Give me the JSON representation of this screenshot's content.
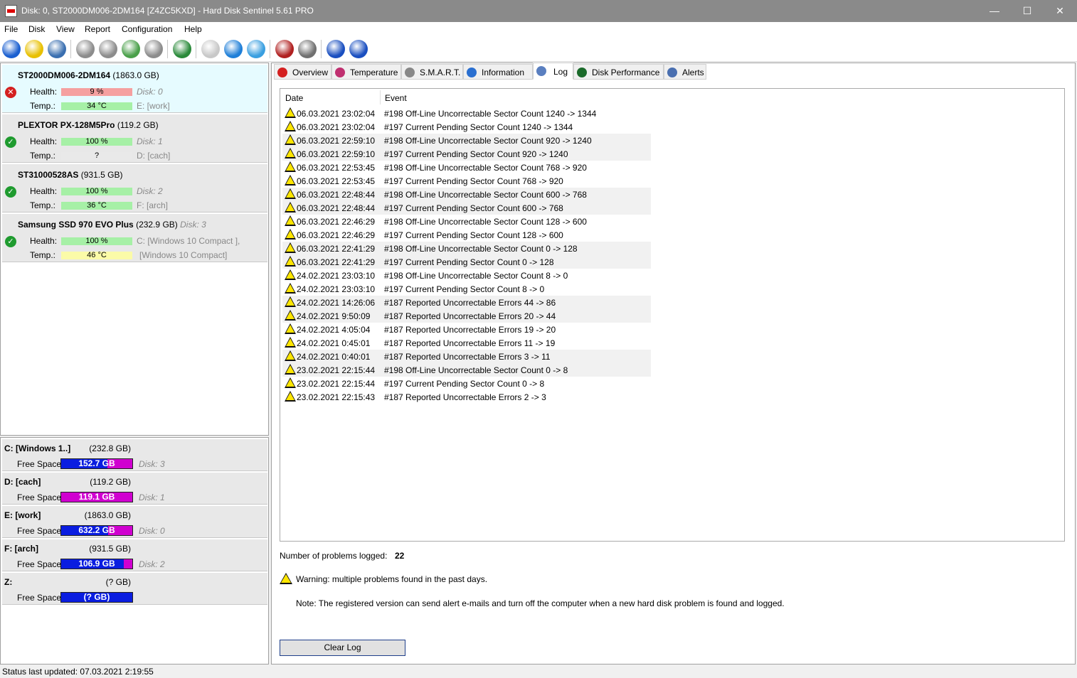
{
  "window": {
    "title": "Disk: 0, ST2000DM006-2DM164 [Z4ZC5KXD]  -  Hard Disk Sentinel 5.61 PRO",
    "minimize": "—",
    "maximize": "☐",
    "close": "✕"
  },
  "menu": [
    "File",
    "Disk",
    "View",
    "Report",
    "Configuration",
    "Help"
  ],
  "toolbar": {
    "icons": [
      "refresh-icon",
      "alert-icon",
      "disk-icon",
      "hdd-icon-1",
      "hdd-icon-2",
      "hdd-icon-3",
      "hdd-icon-4",
      "globe-icon",
      "report-icon",
      "sync-icon",
      "network-icon",
      "chart-icon",
      "sound-icon",
      "help-icon",
      "info-icon"
    ],
    "colors": [
      "#1a5fd0",
      "#e8c000",
      "#3a6fb0",
      "#8c8c8c",
      "#8c8c8c",
      "#4aa04a",
      "#8c8c8c",
      "#2a8a3a",
      "#c8c8c8",
      "#1f7fd8",
      "#3a9fe0",
      "#b02020",
      "#707070",
      "#1a4fc0",
      "#1a4fc0"
    ]
  },
  "disks": [
    {
      "name": "ST2000DM006-2DM164",
      "size": "(1863.0 GB)",
      "disk_no": "",
      "status": "bad",
      "health_label": "Health:",
      "health": "9 %",
      "health_fraction": 0.09,
      "health_color": "red",
      "temp_label": "Temp.:",
      "temp": "34 °C",
      "temp_color": "green",
      "info1": "Disk: 0",
      "info2": "E: [work]"
    },
    {
      "name": "PLEXTOR PX-128M5Pro",
      "size": "(119.2 GB)",
      "disk_no": "",
      "status": "ok",
      "health_label": "Health:",
      "health": "100 %",
      "health_fraction": 1.0,
      "health_color": "green",
      "temp_label": "Temp.:",
      "temp": "?",
      "temp_color": "gray",
      "info1": "Disk: 1",
      "info2": "D: [cach]"
    },
    {
      "name": "ST31000528AS",
      "size": "(931.5 GB)",
      "disk_no": "",
      "status": "ok",
      "health_label": "Health:",
      "health": "100 %",
      "health_fraction": 1.0,
      "health_color": "green",
      "temp_label": "Temp.:",
      "temp": "36 °C",
      "temp_color": "green",
      "info1": "Disk: 2",
      "info2": "F: [arch]"
    },
    {
      "name": "Samsung SSD 970 EVO Plus",
      "size": "(232.9 GB)",
      "disk_no": "Disk: 3",
      "status": "ok",
      "health_label": "Health:",
      "health": "100 %",
      "health_fraction": 1.0,
      "health_color": "green",
      "temp_label": "Temp.:",
      "temp": "46 °C",
      "temp_color": "yellow",
      "info1": "C: [Windows 10 Compact ],",
      "info2": "[Windows 10 Compact]"
    }
  ],
  "volumes": [
    {
      "name": "C: [Windows 1..]",
      "size": "(232.8 GB)",
      "free_label": "Free Space",
      "free": "152.7 GB",
      "free_fraction": 0.65,
      "disk": "Disk: 3"
    },
    {
      "name": "D: [cach]",
      "size": "(119.2 GB)",
      "free_label": "Free Space",
      "free": "119.1 GB",
      "free_fraction": 0.0,
      "disk": "Disk: 1"
    },
    {
      "name": "E: [work]",
      "size": "(1863.0 GB)",
      "free_label": "Free Space",
      "free": "632.2 GB",
      "free_fraction": 0.66,
      "disk": "Disk: 0"
    },
    {
      "name": "F: [arch]",
      "size": "(931.5 GB)",
      "free_label": "Free Space",
      "free": "106.9 GB",
      "free_fraction": 0.88,
      "disk": "Disk: 2"
    },
    {
      "name": "Z:",
      "size": "(? GB)",
      "free_label": "Free Space",
      "free": "(? GB)",
      "free_fraction": 1.0,
      "disk": ""
    }
  ],
  "tabs": [
    {
      "label": "Overview",
      "icon": "error-icon",
      "color": "#d42020"
    },
    {
      "label": "Temperature",
      "icon": "thermometer-icon",
      "color": "#c03070"
    },
    {
      "label": "S.M.A.R.T.",
      "icon": "smart-icon",
      "color": "#888888"
    },
    {
      "label": "Information",
      "icon": "info-icon",
      "color": "#2a6fd0"
    },
    {
      "label": "Log",
      "icon": "log-icon",
      "color": "#5a7fc0"
    },
    {
      "label": "Disk Performance",
      "icon": "performance-icon",
      "color": "#1a6a2a"
    },
    {
      "label": "Alerts",
      "icon": "alerts-icon",
      "color": "#4a6fb0"
    }
  ],
  "active_tab": "Log",
  "log": {
    "header_date": "Date",
    "header_event": "Event",
    "rows": [
      {
        "date": "06.03.2021 23:02:04",
        "event": "#198  Off-Line Uncorrectable Sector Count  1240 -> 1344"
      },
      {
        "date": "06.03.2021 23:02:04",
        "event": "#197  Current Pending Sector Count  1240 -> 1344"
      },
      {
        "date": "06.03.2021 22:59:10",
        "event": "#198  Off-Line Uncorrectable Sector Count  920 -> 1240"
      },
      {
        "date": "06.03.2021 22:59:10",
        "event": "#197  Current Pending Sector Count  920 -> 1240"
      },
      {
        "date": "06.03.2021 22:53:45",
        "event": "#198  Off-Line Uncorrectable Sector Count  768 -> 920"
      },
      {
        "date": "06.03.2021 22:53:45",
        "event": "#197  Current Pending Sector Count  768 -> 920"
      },
      {
        "date": "06.03.2021 22:48:44",
        "event": "#198  Off-Line Uncorrectable Sector Count  600 -> 768"
      },
      {
        "date": "06.03.2021 22:48:44",
        "event": "#197  Current Pending Sector Count  600 -> 768"
      },
      {
        "date": "06.03.2021 22:46:29",
        "event": "#198  Off-Line Uncorrectable Sector Count  128 -> 600"
      },
      {
        "date": "06.03.2021 22:46:29",
        "event": "#197  Current Pending Sector Count  128 -> 600"
      },
      {
        "date": "06.03.2021 22:41:29",
        "event": "#198  Off-Line Uncorrectable Sector Count  0 -> 128"
      },
      {
        "date": "06.03.2021 22:41:29",
        "event": "#197  Current Pending Sector Count  0 -> 128"
      },
      {
        "date": "24.02.2021 23:03:10",
        "event": "#198  Off-Line Uncorrectable Sector Count  8 -> 0"
      },
      {
        "date": "24.02.2021 23:03:10",
        "event": "#197  Current Pending Sector Count  8 -> 0"
      },
      {
        "date": "24.02.2021 14:26:06",
        "event": "#187  Reported Uncorrectable Errors  44 -> 86"
      },
      {
        "date": "24.02.2021 9:50:09",
        "event": "#187  Reported Uncorrectable Errors  20 -> 44"
      },
      {
        "date": "24.02.2021 4:05:04",
        "event": "#187  Reported Uncorrectable Errors  19 -> 20"
      },
      {
        "date": "24.02.2021 0:45:01",
        "event": "#187  Reported Uncorrectable Errors  11 -> 19"
      },
      {
        "date": "24.02.2021 0:40:01",
        "event": "#187  Reported Uncorrectable Errors  3 -> 11"
      },
      {
        "date": "23.02.2021 22:15:44",
        "event": "#198  Off-Line Uncorrectable Sector Count  0 -> 8"
      },
      {
        "date": "23.02.2021 22:15:44",
        "event": "#197  Current Pending Sector Count  0 -> 8"
      },
      {
        "date": "23.02.2021 22:15:43",
        "event": "#187  Reported Uncorrectable Errors  2 -> 3"
      }
    ]
  },
  "summary": {
    "label": "Number of problems logged:",
    "count": "22",
    "warning": "Warning: multiple problems found in the past days.",
    "note": "Note: The registered version can send alert e-mails and turn off the computer when a new hard disk problem is found and logged."
  },
  "clear_button": "Clear Log",
  "status_bar": "Status last updated: 07.03.2021 2:19:55",
  "colors": {
    "titlebar": "#8a8a8a",
    "selected_disk": "#e6fbff",
    "free_space_used": "#d000d0",
    "free_space_free": "#0a1de0"
  }
}
